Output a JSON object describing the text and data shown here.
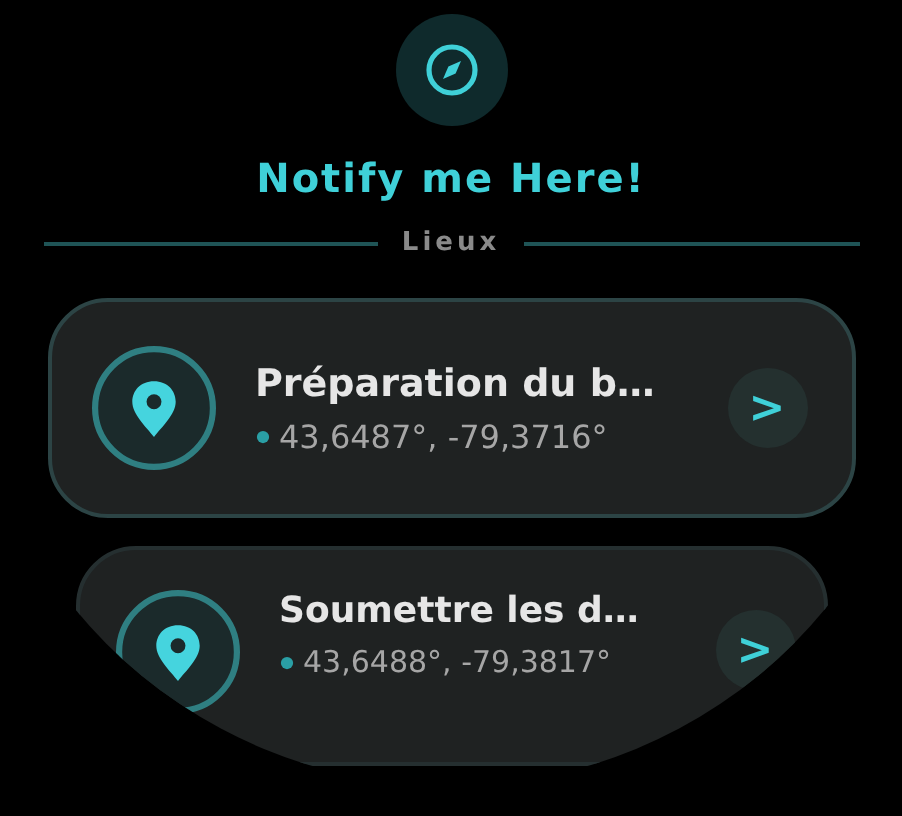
{
  "header": {
    "title": "Notify me Here!"
  },
  "section": {
    "label": "Lieux"
  },
  "places": [
    {
      "title": "Préparation du b…",
      "coordinates": "43,6487°, -79,3716°",
      "action": ">"
    },
    {
      "title": "Soumettre les d…",
      "coordinates": "43,6488°, -79,3817°",
      "action": ">"
    }
  ]
}
